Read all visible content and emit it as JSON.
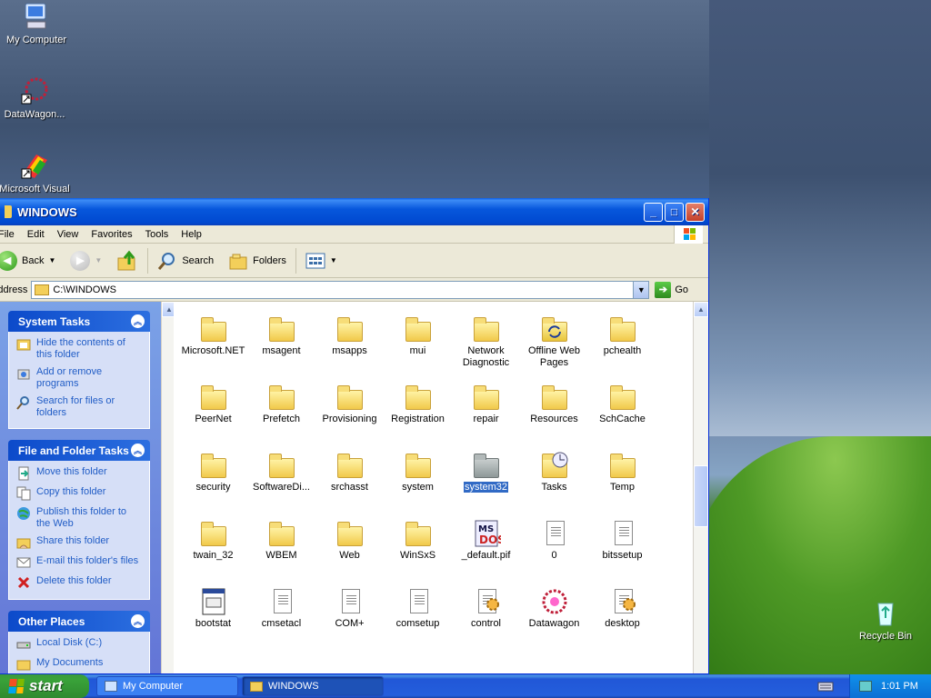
{
  "desktop": {
    "icons": [
      {
        "label": "My Computer",
        "icon": "my-computer-icon"
      },
      {
        "label": "DataWagon...",
        "icon": "datawagon-shortcut-icon"
      },
      {
        "label": "Microsoft Visual",
        "icon": "visual-studio-shortcut-icon"
      }
    ],
    "recycle_bin": {
      "label": "Recycle Bin",
      "icon": "recycle-bin-icon"
    }
  },
  "window": {
    "title": "WINDOWS",
    "menu": [
      "File",
      "Edit",
      "View",
      "Favorites",
      "Tools",
      "Help"
    ],
    "toolbar": {
      "back": "Back",
      "search": "Search",
      "folders": "Folders"
    },
    "address": {
      "label": "Address",
      "value": "C:\\WINDOWS",
      "go": "Go"
    },
    "task_panes": [
      {
        "title": "System Tasks",
        "items": [
          {
            "label": "Hide the contents of this folder",
            "icon": "hide-contents-icon"
          },
          {
            "label": "Add or remove programs",
            "icon": "add-remove-programs-icon"
          },
          {
            "label": "Search for files or folders",
            "icon": "search-icon"
          }
        ]
      },
      {
        "title": "File and Folder Tasks",
        "items": [
          {
            "label": "Move this folder",
            "icon": "move-folder-icon"
          },
          {
            "label": "Copy this folder",
            "icon": "copy-folder-icon"
          },
          {
            "label": "Publish this folder to the Web",
            "icon": "publish-web-icon"
          },
          {
            "label": "Share this folder",
            "icon": "share-folder-icon"
          },
          {
            "label": "E-mail this folder's files",
            "icon": "email-icon"
          },
          {
            "label": "Delete this folder",
            "icon": "delete-icon"
          }
        ]
      },
      {
        "title": "Other Places",
        "items": [
          {
            "label": "Local Disk (C:)",
            "icon": "local-disk-icon"
          },
          {
            "label": "My Documents",
            "icon": "my-documents-icon"
          }
        ]
      }
    ],
    "files": [
      {
        "name": "Microsoft.NET",
        "type": "folder"
      },
      {
        "name": "msagent",
        "type": "folder"
      },
      {
        "name": "msapps",
        "type": "folder"
      },
      {
        "name": "mui",
        "type": "folder"
      },
      {
        "name": "Network Diagnostic",
        "type": "folder"
      },
      {
        "name": "Offline Web Pages",
        "type": "special-folder"
      },
      {
        "name": "pchealth",
        "type": "folder"
      },
      {
        "name": "PeerNet",
        "type": "folder"
      },
      {
        "name": "Prefetch",
        "type": "folder"
      },
      {
        "name": "Provisioning",
        "type": "folder"
      },
      {
        "name": "Registration",
        "type": "folder"
      },
      {
        "name": "repair",
        "type": "folder"
      },
      {
        "name": "Resources",
        "type": "folder"
      },
      {
        "name": "SchCache",
        "type": "folder"
      },
      {
        "name": "security",
        "type": "folder"
      },
      {
        "name": "SoftwareDi...",
        "type": "folder"
      },
      {
        "name": "srchasst",
        "type": "folder"
      },
      {
        "name": "system",
        "type": "folder"
      },
      {
        "name": "system32",
        "type": "grey-folder",
        "selected": true
      },
      {
        "name": "Tasks",
        "type": "tasks-folder"
      },
      {
        "name": "Temp",
        "type": "folder"
      },
      {
        "name": "twain_32",
        "type": "folder"
      },
      {
        "name": "WBEM",
        "type": "folder"
      },
      {
        "name": "Web",
        "type": "folder"
      },
      {
        "name": "WinSxS",
        "type": "folder"
      },
      {
        "name": "_default.pif",
        "type": "pif"
      },
      {
        "name": "0",
        "type": "doc"
      },
      {
        "name": "bitssetup",
        "type": "doc"
      },
      {
        "name": "bootstat",
        "type": "bootstat"
      },
      {
        "name": "cmsetacl",
        "type": "doc"
      },
      {
        "name": "COM+",
        "type": "doc"
      },
      {
        "name": "comsetup",
        "type": "doc"
      },
      {
        "name": "control",
        "type": "config"
      },
      {
        "name": "Datawagon",
        "type": "datawagon"
      },
      {
        "name": "desktop",
        "type": "config"
      }
    ]
  },
  "taskbar": {
    "start": "start",
    "tasks": [
      {
        "label": "My Computer",
        "icon": "my-computer-icon"
      },
      {
        "label": "WINDOWS",
        "icon": "folder-icon",
        "active": true
      }
    ],
    "clock": "1:01 PM"
  }
}
